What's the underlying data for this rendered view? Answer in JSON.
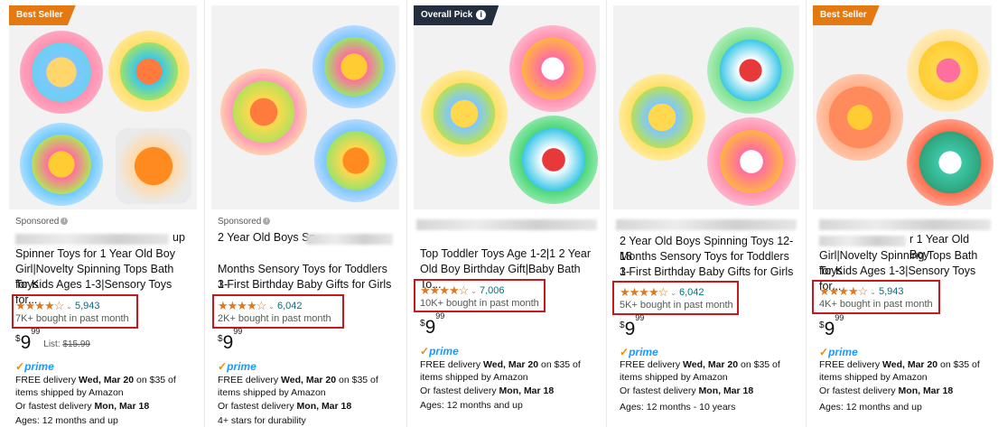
{
  "cards": [
    {
      "badge": "Best Seller",
      "sponsored": "Sponsored",
      "title_line1": "up",
      "title_line2": "Spinner Toys for 1 Year Old Boy",
      "title_line3": "Girl|Novelty Spinning Tops Bath Toys",
      "title_line4": "for Kids Ages 1-3|Sensory Toys for...",
      "stars": "★★★★☆",
      "chev": "⌄",
      "reviews": "5,943",
      "bought": "7K+ bought in past month",
      "price_whole": "9",
      "price_frac": "99",
      "currency": "$",
      "list_label": "List:",
      "list_price": "$15.99",
      "prime": "prime",
      "delivery_pre": "FREE delivery ",
      "delivery_date": "Wed, Mar 20",
      "delivery_post": " on $35 of",
      "delivery_line2": "items shipped by Amazon",
      "fast_pre": "Or fastest delivery ",
      "fast_date": "Mon, Mar 18",
      "extra": "Ages: 12 months and up"
    },
    {
      "badge": "",
      "sponsored": "Sponsored",
      "title_line1": "2 Year Old Boys Sp",
      "title_line2": "Months Sensory Toys for Toddlers 1-",
      "title_line3": "3 First Birthday Baby Gifts for Girls",
      "stars": "★★★★☆",
      "chev": "⌄",
      "reviews": "6,042",
      "bought": "2K+ bought in past month",
      "price_whole": "9",
      "price_frac": "99",
      "currency": "$",
      "prime": "prime",
      "delivery_pre": "FREE delivery ",
      "delivery_date": "Wed, Mar 20",
      "delivery_post": " on $35 of",
      "delivery_line2": "items shipped by Amazon",
      "fast_pre": "Or fastest delivery ",
      "fast_date": "Mon, Mar 18",
      "extra": "4+ stars for durability"
    },
    {
      "badge": "Overall Pick",
      "info": "i",
      "title_line1": "Top Toddler Toys Age 1-2|1 2 Year",
      "title_line2": "Old Boy Birthday Gift|Baby Bath To...",
      "stars": "★★★★☆",
      "chev": "⌄",
      "reviews": "7,006",
      "bought": "10K+ bought in past month",
      "price_whole": "9",
      "price_frac": "99",
      "currency": "$",
      "prime": "prime",
      "delivery_pre": "FREE delivery ",
      "delivery_date": "Wed, Mar 20",
      "delivery_post": " on $35 of",
      "delivery_line2": "items shipped by Amazon",
      "fast_pre": "Or fastest delivery ",
      "fast_date": "Mon, Mar 18",
      "extra": "Ages: 12 months and up"
    },
    {
      "badge": "",
      "title_line1": "2 Year Old Boys Spinning Toys 12-18",
      "title_line2": "Months Sensory Toys for Toddlers 1-",
      "title_line3": "3 First Birthday Baby Gifts for Girls",
      "stars": "★★★★☆",
      "chev": "⌄",
      "reviews": "6,042",
      "bought": "5K+ bought in past month",
      "price_whole": "9",
      "price_frac": "99",
      "currency": "$",
      "prime": "prime",
      "delivery_pre": "FREE delivery ",
      "delivery_date": "Wed, Mar 20",
      "delivery_post": " on $35 of",
      "delivery_line2": "items shipped by Amazon",
      "fast_pre": "Or fastest delivery ",
      "fast_date": "Mon, Mar 18",
      "extra": "Ages: 12 months - 10 years"
    },
    {
      "badge": "Best Seller",
      "title_line1": "r 1 Year Old Boy",
      "title_line2": "Girl|Novelty Spinning Tops Bath Toys",
      "title_line3": "for Kids Ages 1-3|Sensory Toys for...",
      "stars": "★★★★☆",
      "chev": "⌄",
      "reviews": "5,943",
      "bought": "4K+ bought in past month",
      "price_whole": "9",
      "price_frac": "99",
      "currency": "$",
      "prime": "prime",
      "delivery_pre": "FREE delivery ",
      "delivery_date": "Wed, Mar 20",
      "delivery_post": " on $35 of",
      "delivery_line2": "items shipped by Amazon",
      "fast_pre": "Or fastest delivery ",
      "fast_date": "Mon, Mar 18",
      "extra": "Ages: 12 months and up"
    }
  ],
  "colors": {
    "badge_orange": "#e47911",
    "badge_dark": "#232f3e",
    "star": "#de7921",
    "link": "#007185",
    "highlight_box": "#c7191b",
    "prime_blue": "#1a98ff"
  },
  "icons": [
    "info-icon",
    "star-rating-icon",
    "chevron-down-icon",
    "prime-check-icon"
  ]
}
